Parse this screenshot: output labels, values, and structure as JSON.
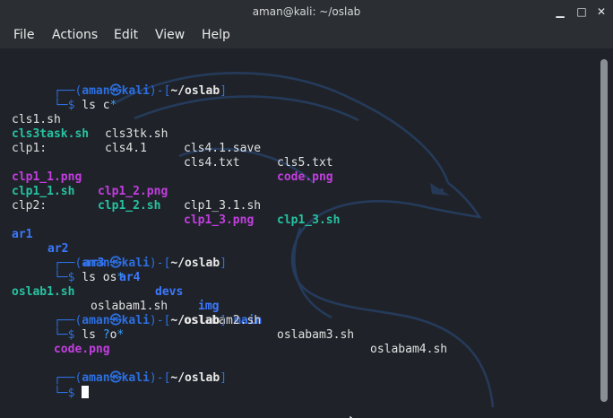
{
  "window": {
    "title": "aman@kali: ~/oslab",
    "buttons": {
      "minimize": "▁",
      "maximize": "□",
      "close": "✕"
    }
  },
  "menu": [
    "File",
    "Actions",
    "Edit",
    "View",
    "Help"
  ],
  "prompt": {
    "open": "┌──(",
    "user": "aman",
    "at": "㉿",
    "host": "kali",
    "mid": ")-[",
    "path": "~/oslab",
    "close": "]",
    "second": "└─$ "
  },
  "cmds": {
    "c1_a": "ls c",
    "c1_b": "*",
    "c2_a": "ls os",
    "c2_b": "*",
    "c3_a": "ls ",
    "c3_b": "?",
    "c3_c": "o",
    "c3_d": "*"
  },
  "listing1": {
    "row1": [
      "cls1.sh",
      "cls3tk.sh",
      "cls4.1.save",
      "cls5.txt"
    ],
    "row2": [
      "cls3task.sh",
      "cls4.1",
      "cls4.txt",
      "code.png"
    ]
  },
  "clp1": {
    "header": "clp1:",
    "row1": [
      "clp1_1.png",
      "clp1_2.png",
      "clp1_3.1.sh",
      "clp1_3.sh"
    ],
    "row2": [
      "clp1_1.sh",
      "clp1_2.sh",
      "clp1_3.png"
    ]
  },
  "clp2": {
    "header": "clp2:",
    "row": [
      "ar1",
      "ar2",
      "ar3",
      "ar4",
      "devs",
      "img",
      "main"
    ]
  },
  "listing2": [
    "oslab1.sh",
    "oslabam1.sh",
    "oslabam2.sh",
    "oslabam3.sh",
    "oslabam4.sh"
  ],
  "listing3": [
    "code.png"
  ],
  "colors": {
    "background": "#1f2329",
    "prompt": "#2d6fe0",
    "executable": "#27c2a2",
    "image": "#c33ee0",
    "directory": "#3b78ff"
  }
}
